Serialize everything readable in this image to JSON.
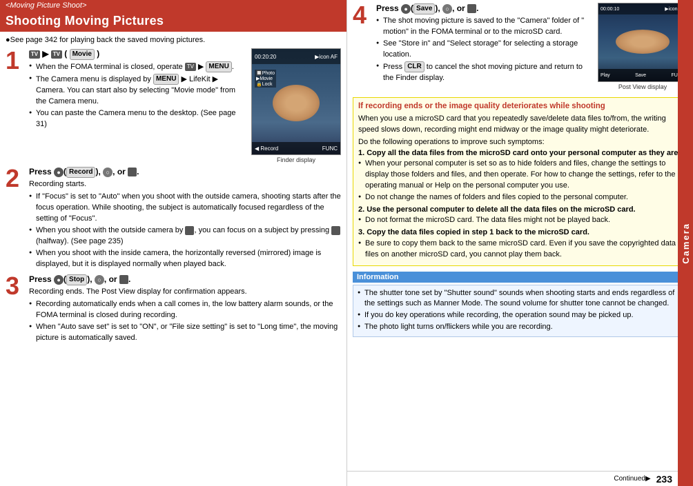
{
  "header": {
    "breadcrumb": "<Moving Picture Shoot>",
    "title": "Shooting Moving Pictures"
  },
  "left": {
    "intro": "●See page 342 for playing back the saved moving pictures.",
    "step1": {
      "number": "1",
      "title_parts": [
        "TV icon",
        "▶",
        "TV icon",
        "(",
        "Movie",
        ")"
      ],
      "bullets": [
        "When the FOMA terminal is closed, operate TV ▶ MENU.",
        "The Camera menu is displayed by MENU ▶ LifeKit ▶ Camera. You can start also by selecting \"Movie mode\" from the Camera menu.",
        "You can paste the Camera menu to the desktop. (See page 31)"
      ]
    },
    "step2": {
      "number": "2",
      "title": "Press ●( Record ), ○, or ⬛.",
      "intro": "Recording starts.",
      "bullets": [
        "If \"Focus\" is set to \"Auto\" when you shoot with the outside camera, shooting starts after the focus operation. While shooting, the subject is automatically focused regardless of the setting of \"Focus\".",
        "When you shoot with the outside camera by ⬛, you can focus on a subject by pressing ⬛(halfway). (See page 235)",
        "When you shoot with the inside camera, the horizontally reversed (mirrored) image is displayed, but it is displayed normally when played back."
      ]
    },
    "step3": {
      "number": "3",
      "title": "Press ●( Stop ), ○, or ⬛.",
      "intro": "Recording ends. The Post View display for confirmation appears.",
      "bullets": [
        "Recording automatically ends when a call comes in, the low battery alarm sounds, or the FOMA terminal is closed during recording.",
        "When \"Auto save set\" is set to \"ON\", or \"File size setting\" is set to \"Long time\", the moving picture is automatically saved."
      ]
    },
    "finder_label": "Finder display",
    "timer": "00:20:20"
  },
  "right": {
    "step4": {
      "number": "4",
      "title": "Press ●( Save ), ○, or ⬛.",
      "bullets": [
        "The shot moving picture is saved to the \"Camera\" folder of \" motion\" in the FOMA terminal or to the microSD card.",
        "See \"Store in\" and \"Select storage\" for selecting a storage location.",
        "Press CLR to cancel the shot moving picture and return to the Finder display."
      ]
    },
    "post_view_label": "Post View display",
    "post_view_timer": "00:00:10",
    "yellow_box": {
      "title": "If recording ends or the image quality deteriorates while shooting",
      "body": "When you use a microSD card that you repeatedly save/delete data files to/from, the writing speed slows down, recording might end midway or the image quality might deteriorate.",
      "do_following": "Do the following operations to improve such symptoms:",
      "items": [
        {
          "num": "1",
          "label": "Copy all the data files from the microSD card onto your personal computer as they are.",
          "sub_bullets": [
            "When your personal computer is set so as to hide folders and files, change the settings to display those folders and files, and then operate. For how to change the settings, refer to the operating manual or Help on the personal computer you use.",
            "Do not change the names of folders and files copied to the personal computer."
          ]
        },
        {
          "num": "2",
          "label": "Use the personal computer to delete all the data files on the microSD card.",
          "sub_bullets": [
            "Do not format the microSD card. The data files might not be played back."
          ]
        },
        {
          "num": "3",
          "label": "Copy the data files copied in step 1 back to the microSD card.",
          "sub_bullets": [
            "Be sure to copy them back to the same microSD card. Even if you save the copyrighted data files on another microSD card, you cannot play them back."
          ]
        }
      ]
    },
    "information_label": "Information",
    "info_bullets": [
      "The shutter tone set by \"Shutter sound\" sounds when shooting starts and ends regardless of the settings such as Manner Mode. The sound volume for shutter tone cannot be changed.",
      "If you do key operations while recording, the operation sound may be picked up.",
      "The photo light turns on/flickers while you are recording."
    ]
  },
  "sidebar": {
    "label": "Camera"
  },
  "footer": {
    "page_number": "233",
    "continued": "Continued▶"
  }
}
